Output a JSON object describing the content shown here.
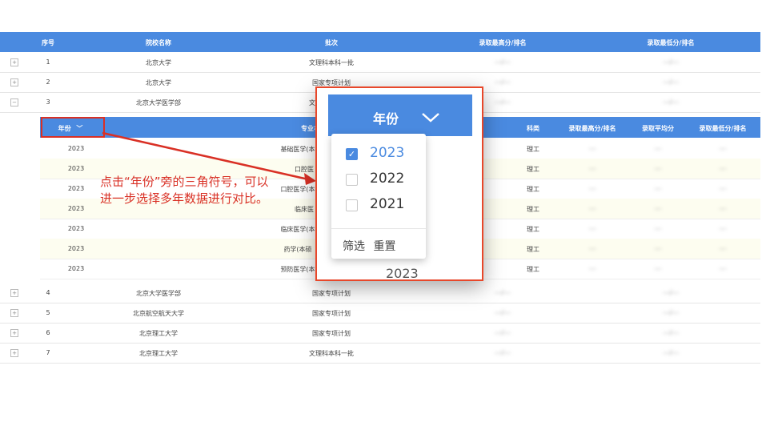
{
  "table": {
    "headers": [
      "序号",
      "院校名称",
      "批次",
      "录取最高分/排名",
      "录取最低分/排名"
    ],
    "rows": [
      {
        "no": "1",
        "school": "北京大学",
        "batch": "文理科本科一批",
        "max": "---/---",
        "min": "---/---",
        "expander": "+"
      },
      {
        "no": "2",
        "school": "北京大学",
        "batch": "国家专项计划",
        "max": "---/---",
        "min": "---/---",
        "expander": "+"
      },
      {
        "no": "3",
        "school": "北京大学医学部",
        "batch": "文",
        "max": "---/---",
        "min": "---/---",
        "expander": "−"
      },
      {
        "no": "4",
        "school": "北京大学医学部",
        "batch": "国家专项计划",
        "max": "---/---",
        "min": "---/---",
        "expander": "+"
      },
      {
        "no": "5",
        "school": "北京航空航天大学",
        "batch": "国家专项计划",
        "max": "---/---",
        "min": "---/---",
        "expander": "+"
      },
      {
        "no": "6",
        "school": "北京理工大学",
        "batch": "国家专项计划",
        "max": "---/---",
        "min": "---/---",
        "expander": "+"
      },
      {
        "no": "7",
        "school": "北京理工大学",
        "batch": "文理科本科一批",
        "max": "---/---",
        "min": "---/---",
        "expander": "+"
      }
    ]
  },
  "subtable": {
    "headers": {
      "year": "年份",
      "major": "专业名",
      "type": "科类",
      "max": "录取最高分/排名",
      "avg": "录取平均分",
      "min": "录取最低分/排名"
    },
    "rows": [
      {
        "year": "2023",
        "major": "基础医学(本",
        "type": "理工"
      },
      {
        "year": "2023",
        "major": "口腔医",
        "type": "理工"
      },
      {
        "year": "2023",
        "major": "口腔医学(本",
        "type": "理工"
      },
      {
        "year": "2023",
        "major": "临床医",
        "type": "理工"
      },
      {
        "year": "2023",
        "major": "临床医学(本",
        "type": "理工"
      },
      {
        "year": "2023",
        "major": "药学(本硕",
        "type": "理工"
      },
      {
        "year": "2023",
        "major": "预防医学(本",
        "type": "理工"
      }
    ]
  },
  "annotation": {
    "text": "点击“年份”旁的三角符号，可以进一步选择多年数据进行对比。"
  },
  "popup": {
    "header": "年份",
    "options": [
      {
        "label": "2023",
        "checked": true
      },
      {
        "label": "2022",
        "checked": false
      },
      {
        "label": "2021",
        "checked": false
      }
    ],
    "filter_label": "筛选",
    "reset_label": "重置",
    "cell_value": "2023"
  },
  "colors": {
    "header": "#4a8ae0",
    "highlight": "#d93025"
  }
}
